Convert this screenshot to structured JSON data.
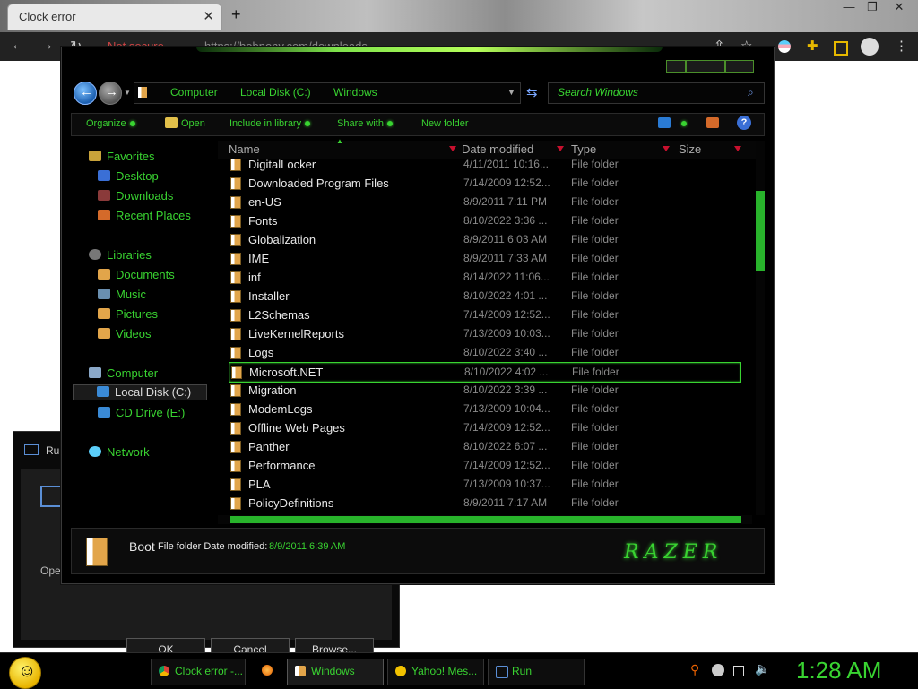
{
  "browser": {
    "tab_title": "Clock error",
    "tab_close": "✕",
    "new_tab": "+",
    "window_controls": [
      "—",
      "❐",
      "✕"
    ],
    "not_secure": "Not secure",
    "url_host": "https://bobnony.com",
    "url_path": "/downloads"
  },
  "run_dialog": {
    "title": "Run",
    "open_label": "Open:",
    "buttons": [
      "OK",
      "Cancel",
      "Browse..."
    ]
  },
  "explorer": {
    "breadcrumb": [
      "Computer",
      "Local Disk (C:)",
      "Windows"
    ],
    "search_placeholder": "Search Windows",
    "commands": [
      "Organize",
      "Open",
      "Include in library",
      "Share with",
      "New folder"
    ],
    "nav": {
      "favorites": "Favorites",
      "favorites_items": [
        "Desktop",
        "Downloads",
        "Recent Places"
      ],
      "libraries": "Libraries",
      "libraries_items": [
        "Documents",
        "Music",
        "Pictures",
        "Videos"
      ],
      "computer": "Computer",
      "computer_items": [
        "Local Disk (C:)",
        "CD Drive (E:)"
      ],
      "network": "Network"
    },
    "columns": [
      "Name",
      "Date modified",
      "Type",
      "Size"
    ],
    "files": [
      {
        "name": "DigitalLocker",
        "date": "4/11/2011 10:16...",
        "type": "File folder"
      },
      {
        "name": "Downloaded Program Files",
        "date": "7/14/2009 12:52...",
        "type": "File folder"
      },
      {
        "name": "en-US",
        "date": "8/9/2011 7:11 PM",
        "type": "File folder"
      },
      {
        "name": "Fonts",
        "date": "8/10/2022 3:36 ...",
        "type": "File folder"
      },
      {
        "name": "Globalization",
        "date": "8/9/2011 6:03 AM",
        "type": "File folder"
      },
      {
        "name": "IME",
        "date": "8/9/2011 7:33 AM",
        "type": "File folder"
      },
      {
        "name": "inf",
        "date": "8/14/2022 11:06...",
        "type": "File folder"
      },
      {
        "name": "Installer",
        "date": "8/10/2022 4:01 ...",
        "type": "File folder"
      },
      {
        "name": "L2Schemas",
        "date": "7/14/2009 12:52...",
        "type": "File folder"
      },
      {
        "name": "LiveKernelReports",
        "date": "7/13/2009 10:03...",
        "type": "File folder"
      },
      {
        "name": "Logs",
        "date": "8/10/2022 3:40 ...",
        "type": "File folder"
      },
      {
        "name": "Microsoft.NET",
        "date": "8/10/2022 4:02 ...",
        "type": "File folder"
      },
      {
        "name": "Migration",
        "date": "8/10/2022 3:39 ...",
        "type": "File folder"
      },
      {
        "name": "ModemLogs",
        "date": "7/13/2009 10:04...",
        "type": "File folder"
      },
      {
        "name": "Offline Web Pages",
        "date": "7/14/2009 12:52...",
        "type": "File folder"
      },
      {
        "name": "Panther",
        "date": "8/10/2022 6:07 ...",
        "type": "File folder"
      },
      {
        "name": "Performance",
        "date": "7/14/2009 12:52...",
        "type": "File folder"
      },
      {
        "name": "PLA",
        "date": "7/13/2009 10:37...",
        "type": "File folder"
      },
      {
        "name": "PolicyDefinitions",
        "date": "8/9/2011 7:17 AM",
        "type": "File folder"
      }
    ],
    "details": {
      "name": "Boot",
      "meta": "File folder Date modified:",
      "value": "8/9/2011 6:39 AM",
      "logo": "RAZER"
    }
  },
  "taskbar": {
    "items": [
      "Clock error -...",
      "Windows",
      "Yahoo! Mes...",
      "Run"
    ],
    "clock": "1:28 AM"
  }
}
